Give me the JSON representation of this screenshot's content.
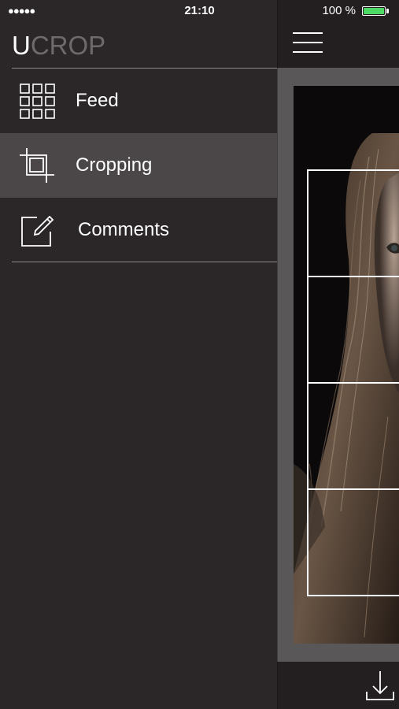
{
  "status_bar": {
    "signal": "●●●●●",
    "time": "21:10",
    "battery_percent": "100 %",
    "battery_level": 1.0,
    "battery_color": "#4cd964"
  },
  "app": {
    "logo_first": "U",
    "logo_rest": "CROP"
  },
  "menu": {
    "items": [
      {
        "label": "Feed",
        "icon": "grid-icon",
        "active": false
      },
      {
        "label": "Cropping",
        "icon": "crop-icon",
        "active": true
      },
      {
        "label": "Comments",
        "icon": "edit-icon",
        "active": false
      }
    ]
  },
  "main": {
    "header_icon": "hamburger-menu-icon",
    "footer_icon": "download-icon",
    "image": "portrait-photo"
  },
  "colors": {
    "drawer_bg": "#2b2627",
    "active_item_bg": "#4b4748",
    "header_bg": "#231f20",
    "logo_dim": "#6e6a6b",
    "text": "#ffffff"
  }
}
